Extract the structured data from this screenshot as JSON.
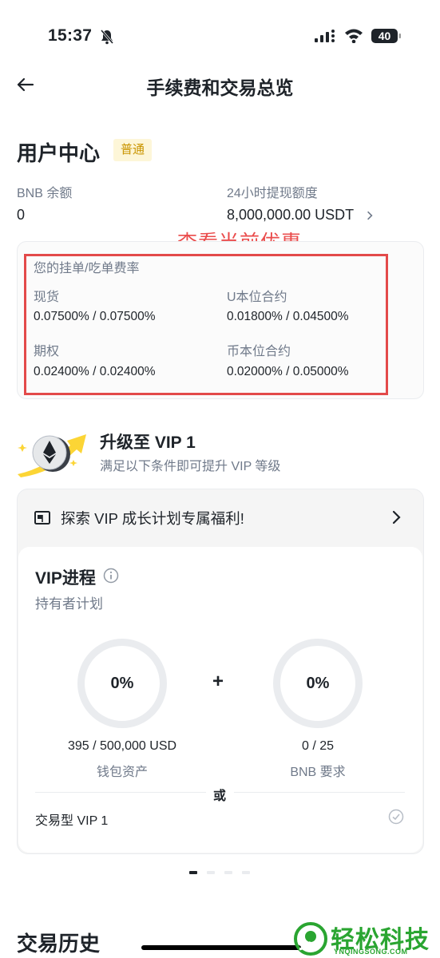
{
  "status_bar": {
    "time": "15:37",
    "battery": "40"
  },
  "nav": {
    "title": "手续费和交易总览"
  },
  "user_center": {
    "title": "用户中心",
    "tier_badge": "普通",
    "bnb_balance_label": "BNB 余额",
    "bnb_balance_value": "0",
    "withdraw_limit_label": "24小时提现额度",
    "withdraw_limit_value": "8,000,000.00 USDT"
  },
  "annotation": "查看当前优惠",
  "fees": {
    "heading": "您的挂单/吃单费率",
    "items": [
      {
        "label": "现货",
        "value": "0.07500% / 0.07500%"
      },
      {
        "label": "U本位合约",
        "value": "0.01800% / 0.04500%"
      },
      {
        "label": "期权",
        "value": "0.02400% / 0.02400%"
      },
      {
        "label": "币本位合约",
        "value": "0.02000% / 0.05000%"
      }
    ]
  },
  "upgrade": {
    "title": "升级至 VIP 1",
    "subtitle": "满足以下条件即可提升 VIP 等级"
  },
  "explore": {
    "label": "探索 VIP 成长计划专属福利!"
  },
  "vip_progress": {
    "title": "VIP进程",
    "subtitle": "持有者计划",
    "requirements": [
      {
        "percent": "0%",
        "value": "395 / 500,000 USD",
        "label": "钱包资产",
        "progress": 0
      },
      {
        "percent": "0%",
        "value": "0 / 25",
        "label": "BNB 要求",
        "progress": 0
      }
    ],
    "plus": "+",
    "or": "或",
    "trading_vip": "交易型 VIP 1"
  },
  "pagination": {
    "pages": 4,
    "active": 0
  },
  "history": {
    "title": "交易历史"
  },
  "watermark": {
    "text": "轻松科技",
    "sub": "YNQINGSONG.COM"
  },
  "colors": {
    "accent_yellow": "#fcd535",
    "badge_text": "#c99400",
    "annotation_red": "#e34a4a",
    "watermark_green": "#2aa531"
  }
}
